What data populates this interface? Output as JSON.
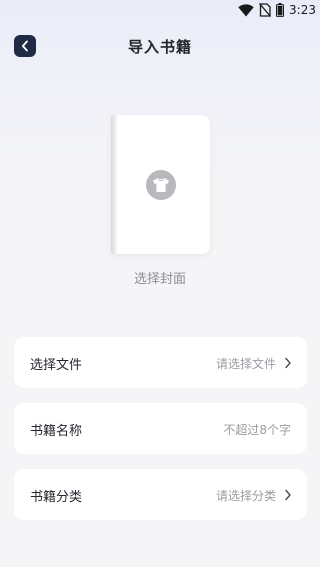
{
  "status_bar": {
    "time": "3:23",
    "icons": [
      "wifi-icon",
      "no-sim-icon",
      "battery-icon"
    ]
  },
  "header": {
    "title": "导入书籍",
    "back_icon": "chevron-left-icon"
  },
  "cover": {
    "label": "选择封面",
    "icon": "shirt-icon"
  },
  "form": {
    "rows": [
      {
        "label": "选择文件",
        "value": "请选择文件",
        "has_chevron": true
      },
      {
        "label": "书籍名称",
        "value": "不超过8个字",
        "has_chevron": false
      },
      {
        "label": "书籍分类",
        "value": "请选择分类",
        "has_chevron": true
      }
    ]
  },
  "colors": {
    "back_button_bg": "#1f2a44",
    "page_bg": "#f5f5f7",
    "card_bg": "#ffffff",
    "placeholder_text": "#9a9ca2"
  }
}
